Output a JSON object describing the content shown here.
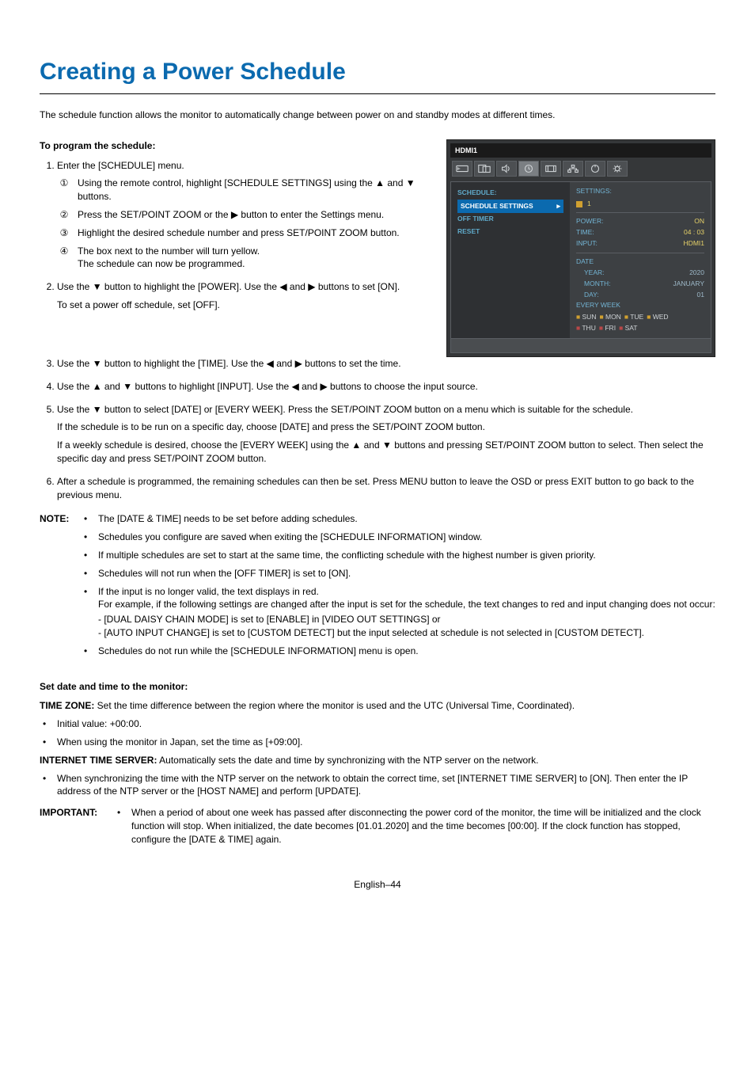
{
  "title": "Creating a Power Schedule",
  "intro": "The schedule function allows the monitor to automatically change between power on and standby modes at different times.",
  "program_head": "To program the schedule:",
  "steps": {
    "s1": "Enter the [SCHEDULE] menu.",
    "s1a": "Using the remote control, highlight [SCHEDULE SETTINGS] using the ▲ and ▼ buttons.",
    "s1b": "Press the SET/POINT ZOOM or the ▶ button to enter the Settings menu.",
    "s1c": "Highlight the desired schedule number and press SET/POINT ZOOM button.",
    "s1d_a": "The box next to the number will turn yellow.",
    "s1d_b": "The schedule can now be programmed.",
    "s2_a": "Use the ▼ button to highlight the [POWER]. Use the ◀ and ▶ buttons to set [ON].",
    "s2_b": "To set a power off schedule, set [OFF].",
    "s3": "Use the ▼ button to highlight the [TIME]. Use the ◀ and ▶ buttons to set the time.",
    "s4": "Use the ▲ and ▼ buttons to highlight [INPUT]. Use the ◀ and ▶ buttons to choose the input source.",
    "s5_a": "Use the ▼ button to select [DATE] or [EVERY WEEK]. Press the SET/POINT ZOOM button on a menu which is suitable for the schedule.",
    "s5_b": "If the schedule is to be run on a specific day, choose [DATE] and press the SET/POINT ZOOM button.",
    "s5_c": "If a weekly schedule is desired, choose the [EVERY WEEK] using the ▲ and ▼ buttons and pressing SET/POINT ZOOM button to select. Then select the specific day and press SET/POINT ZOOM button.",
    "s6": "After a schedule is programmed, the remaining schedules can then be set. Press MENU button to leave the OSD or press EXIT button to go back to the previous menu."
  },
  "note_label": "NOTE:",
  "notes": {
    "n1": "The [DATE & TIME] needs to be set before adding schedules.",
    "n2": "Schedules you configure are saved when exiting the [SCHEDULE INFORMATION] window.",
    "n3": "If multiple schedules are set to start at the same time, the conflicting schedule with the highest number is given priority.",
    "n4": "Schedules will not run when the [OFF TIMER] is set to [ON].",
    "n5_a": "If the input is no longer valid, the text displays in red.",
    "n5_b": "For example, if the following settings are changed after the input is set for the schedule, the text changes to red and input changing does not occur:",
    "n5_c": "- [DUAL DAISY CHAIN MODE] is set to [ENABLE] in [VIDEO OUT SETTINGS] or",
    "n5_d": "- [AUTO INPUT CHANGE] is set to [CUSTOM DETECT] but the input selected at schedule is not selected in [CUSTOM DETECT].",
    "n6": "Schedules do not run while the [SCHEDULE INFORMATION] menu is open."
  },
  "datetime_head": "Set date and time to the monitor:",
  "tz_label": "TIME ZONE:",
  "tz_body": " Set the time difference between the region where the monitor is used and the UTC (Universal Time, Coordinated).",
  "tz_b1": "Initial value: +00:00.",
  "tz_b2": "When using the monitor in Japan, set the time as [+09:00].",
  "its_label": "INTERNET TIME SERVER:",
  "its_body": " Automatically sets the date and time by synchronizing with the NTP server on the network.",
  "its_b1": "When synchronizing the time with the NTP server on the network to obtain the correct time, set [INTERNET TIME SERVER] to [ON]. Then enter the IP address of the NTP server or the [HOST NAME] and perform [UPDATE].",
  "imp_label": "IMPORTANT:",
  "imp_body": "When a period of about one week has passed after disconnecting the power cord of the monitor, the time will be initialized and the clock function will stop. When initialized, the date becomes [01.01.2020] and the time becomes [00:00]. If the clock function has stopped, configure the [DATE & TIME] again.",
  "footer": "English–44",
  "osd": {
    "title": "HDMI1",
    "menu": {
      "head": "SCHEDULE:",
      "items": [
        "SCHEDULE SETTINGS",
        "OFF TIMER",
        "RESET"
      ]
    },
    "settings_label": "SETTINGS:",
    "settings_num": "1",
    "power_lbl": "POWER:",
    "power_val": "ON",
    "time_lbl": "TIME:",
    "time_val": "04 : 03",
    "input_lbl": "INPUT:",
    "input_val": "HDMI1",
    "date_lbl": "DATE",
    "year_lbl": "YEAR:",
    "year_val": "2020",
    "month_lbl": "MONTH:",
    "month_val": "JANUARY",
    "day_lbl": "DAY:",
    "day_val": "01",
    "week_lbl": "EVERY WEEK",
    "days": [
      "SUN",
      "MON",
      "TUE",
      "WED",
      "THU",
      "FRI",
      "SAT"
    ]
  }
}
